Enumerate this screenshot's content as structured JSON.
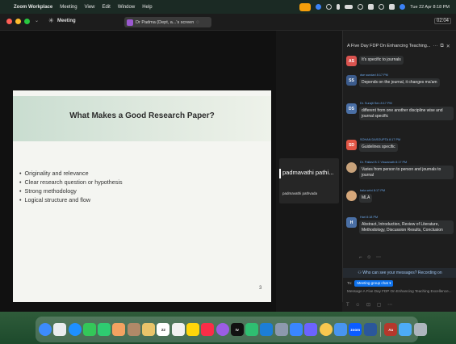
{
  "menubar": {
    "app_name": "Zoom Workplace",
    "menus": [
      "Meeting",
      "View",
      "Edit",
      "Window",
      "Help"
    ],
    "clock": "Tue 22 Apr 8:18 PM"
  },
  "titlebar": {
    "meeting_label": "Meeting",
    "share_label": "Dr Padma (Dept, a...'s screen",
    "timer": "02:04"
  },
  "slide": {
    "title": "What Makes a Good Research Paper?",
    "bullets": [
      "Originality and relevance",
      "Clear research question or hypothesis",
      "Strong methodology",
      "Logical structure and flow"
    ],
    "page_number": "3"
  },
  "participant": {
    "name": "padmavathi pathi...",
    "subname": "padmavathi pathvada"
  },
  "chat": {
    "header_title": "A Five Day FDP On Enhancing Teaching...",
    "messages": [
      {
        "initials": "AS",
        "color": "#d9534f",
        "name": "",
        "text": "It's specific to journals"
      },
      {
        "initials": "SS",
        "color": "#3b5b8c",
        "name": "dse sundari  8:17 PM",
        "text": "Depends on the journal, it changes ma'am"
      },
      {
        "initials": "DS",
        "color": "#4a6fa5",
        "name": "Dr. Surajit Sen  8:17 PM",
        "text": "different from one another discipline wise and journal specific"
      },
      {
        "initials": "SD",
        "color": "#e05545",
        "name": "SOHAN DASGUPTA  8:17 PM",
        "text": "Guidelines specific"
      },
      {
        "initials": "",
        "color": "#c8a27a",
        "name": "Dr. Pallavi B C Viswanath  8:17 PM",
        "text": "Varies from person to person and journals to journal"
      },
      {
        "initials": "",
        "color": "#d6a77a",
        "name": "bala selvi  8:17 PM",
        "text": "MLA"
      },
      {
        "initials": "H",
        "color": "#4a6fa5",
        "name": "Hari  8:18 PM",
        "text": "Abstract, Introduction, Review of Literature, Methodology, Discussion Results, Conclusion"
      }
    ],
    "who_can_see": "Who can see your messages? Recording on",
    "to_label": "To:",
    "to_value": "Meeting group chat",
    "compose_placeholder": "Message A Five Day FDP On Enhancing Teaching Excellence..."
  },
  "dock": {
    "apps": [
      {
        "name": "finder-app",
        "color": "#3d8bfd",
        "label": ""
      },
      {
        "name": "launchpad-app",
        "color": "#e9ecef",
        "label": ""
      },
      {
        "name": "safari-app",
        "color": "#1e90ff",
        "label": ""
      },
      {
        "name": "messages-app",
        "color": "#34c759",
        "label": ""
      },
      {
        "name": "facetime-app",
        "color": "#2ecc71",
        "label": ""
      },
      {
        "name": "photos-app",
        "color": "#f4a261",
        "label": ""
      },
      {
        "name": "contacts-app",
        "color": "#b08968",
        "label": ""
      },
      {
        "name": "preview-app",
        "color": "#e9c46a",
        "label": ""
      },
      {
        "name": "calendar-app",
        "color": "#ffffff",
        "label": "22"
      },
      {
        "name": "reminders-app",
        "color": "#f1f1f1",
        "label": ""
      },
      {
        "name": "notes-app",
        "color": "#ffd60a",
        "label": ""
      },
      {
        "name": "music-app",
        "color": "#fa2d48",
        "label": ""
      },
      {
        "name": "podcasts-app",
        "color": "#9b5de5",
        "label": ""
      },
      {
        "name": "tv-app",
        "color": "#111111",
        "label": "tv"
      },
      {
        "name": "numbers-app",
        "color": "#2fbf71",
        "label": ""
      },
      {
        "name": "app-store-app",
        "color": "#1c7ed6",
        "label": ""
      },
      {
        "name": "system-settings-app",
        "color": "#8d99ae",
        "label": ""
      },
      {
        "name": "keynote-app",
        "color": "#3a86ff",
        "label": ""
      },
      {
        "name": "bbedit-app",
        "color": "#6c63ff",
        "label": ""
      },
      {
        "name": "chrome-app",
        "color": "#f9c74f",
        "label": ""
      },
      {
        "name": "finder-window-app",
        "color": "#4895ef",
        "label": ""
      },
      {
        "name": "zoom-app",
        "color": "#0b5cff",
        "label": "zoom"
      },
      {
        "name": "word-app",
        "color": "#2b579a",
        "label": ""
      },
      {
        "name": "dictionary-app",
        "color": "#b5382c",
        "label": "Aa"
      },
      {
        "name": "downloads-stack",
        "color": "#4dabf7",
        "label": ""
      },
      {
        "name": "trash-can",
        "color": "#adb5bd",
        "label": ""
      }
    ]
  },
  "colors": {
    "zoom_blue": "#0e72ed",
    "chat_name": "#6aa6e8",
    "slide_band": "#c9ddd0"
  }
}
